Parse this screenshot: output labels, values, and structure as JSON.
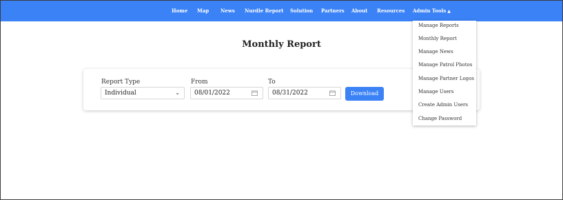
{
  "nav": {
    "items": [
      "Home",
      "Map",
      "News",
      "Nurdle Report",
      "Solution",
      "Partners",
      "About",
      "Resources"
    ],
    "admin_label": "Admin Tools",
    "admin_caret": "▲"
  },
  "dropdown": {
    "items": [
      "Manage Reports",
      "Monthly Report",
      "Manage News",
      "Manage Patrol Photos",
      "Manage Partner Logos",
      "Manage Users",
      "Create Admin Users",
      "Change Password"
    ]
  },
  "page": {
    "title": "Monthly Report"
  },
  "form": {
    "report_type_label": "Report Type",
    "report_type_value": "Individual",
    "from_label": "From",
    "from_value": "08/01/2022",
    "to_label": "To",
    "to_value": "08/31/2022",
    "download_label": "Download"
  },
  "colors": {
    "primary": "#3b82f6"
  }
}
